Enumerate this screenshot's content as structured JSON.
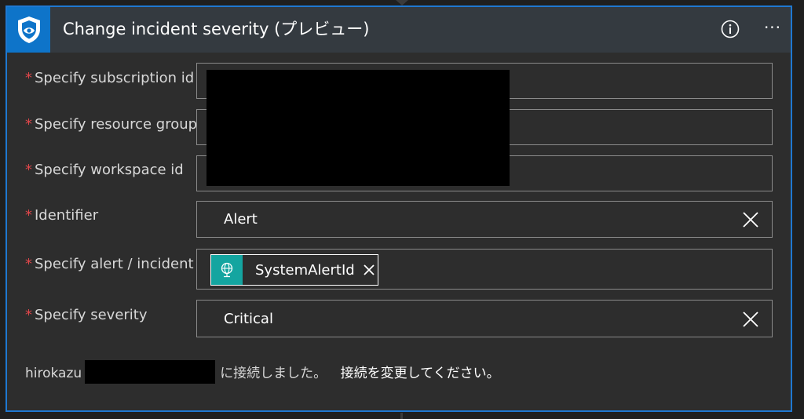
{
  "header": {
    "title": "Change incident severity (プレビュー)",
    "icon": "shield-icon",
    "info_icon": "info-icon",
    "more_label": "···"
  },
  "fields": [
    {
      "label": "Specify subscription id",
      "value": "",
      "redacted": true
    },
    {
      "label": "Specify resource group",
      "value": "",
      "redacted": true
    },
    {
      "label": "Specify workspace id",
      "value": "",
      "redacted": true
    },
    {
      "label": "Identifier",
      "value": "Alert"
    },
    {
      "label": "Specify alert / incident",
      "token": {
        "label": "SystemAlertId",
        "icon": "globe-icon"
      }
    },
    {
      "label": "Specify severity",
      "value": "Critical"
    }
  ],
  "required_marker": "*",
  "connection": {
    "user": "hirokazu",
    "message": "に接続しました。",
    "change_link": "接続を変更してください。"
  },
  "colors": {
    "accent": "#1f78d1",
    "header_bg": "#343a40",
    "card_bg": "#2d2d2d",
    "required": "#e0464a",
    "token_icon_bg": "#14a5a0"
  }
}
